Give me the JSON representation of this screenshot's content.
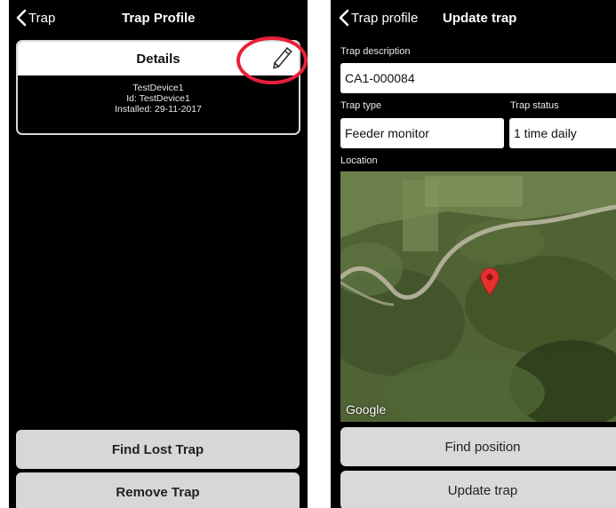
{
  "left_screen": {
    "nav": {
      "back_label": "Trap",
      "title": "Trap Profile"
    },
    "details_card": {
      "header": "Details",
      "device_name": "TestDevice1",
      "id_line": "Id: TestDevice1",
      "installed_line": "Installed: 29-11-2017"
    },
    "buttons": {
      "find_lost": "Find Lost Trap",
      "remove": "Remove Trap"
    },
    "highlight_color": "#e8203a",
    "icons": [
      "chevron-left-icon",
      "pencil-icon"
    ]
  },
  "right_screen": {
    "nav": {
      "back_label": "Trap profile",
      "title": "Update trap"
    },
    "trap_description": {
      "label": "Trap description",
      "value": "CA1-000084"
    },
    "trap_type": {
      "label": "Trap type",
      "value": "Feeder monitor"
    },
    "trap_status": {
      "label": "Trap status",
      "value": "1 time daily"
    },
    "location": {
      "label": "Location",
      "map_attribution": "Google"
    },
    "buttons": {
      "find_position": "Find position",
      "update_trap": "Update trap"
    },
    "icons": [
      "chevron-left-icon",
      "map-pin-icon"
    ]
  }
}
